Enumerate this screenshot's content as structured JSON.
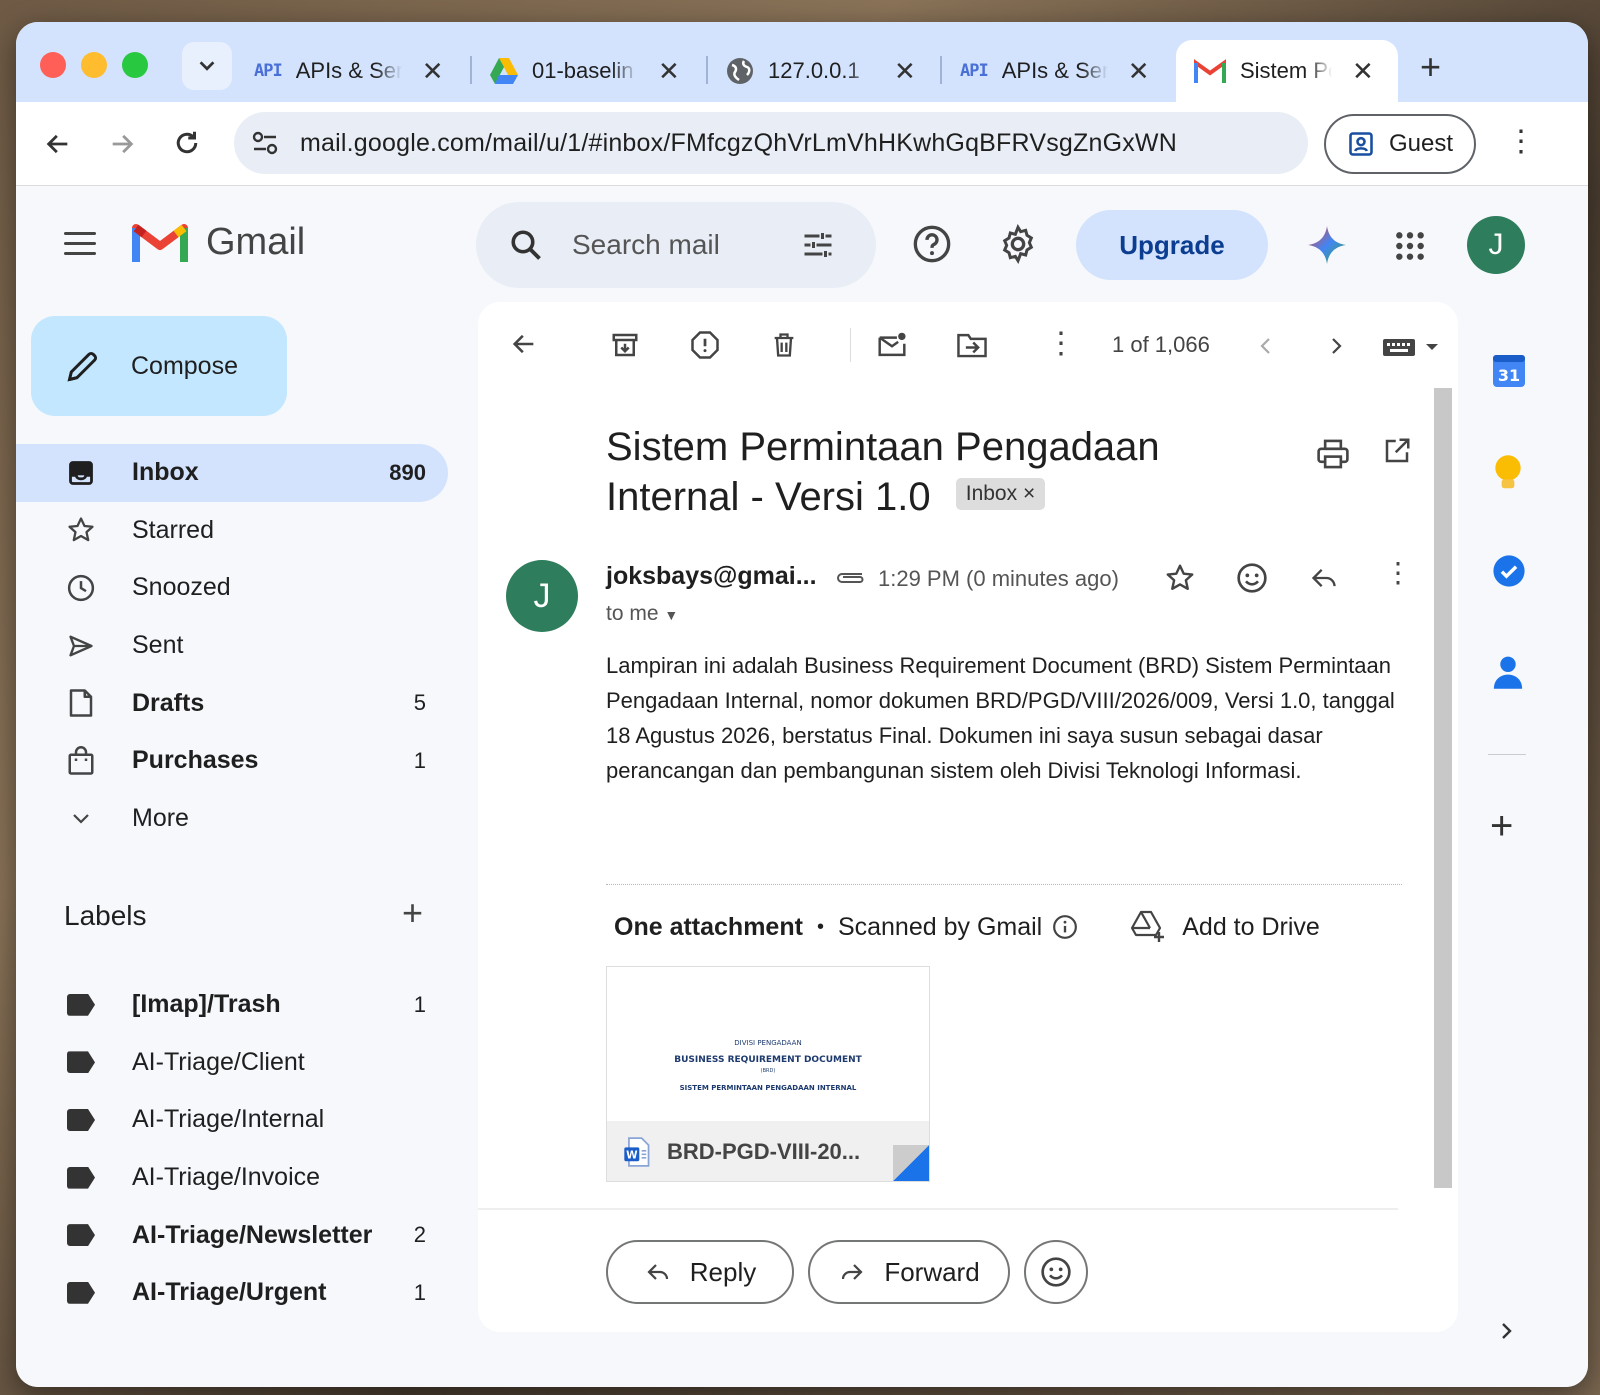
{
  "browser": {
    "tabs": [
      {
        "icon": "api-icon",
        "title": "APIs & Ser"
      },
      {
        "icon": "google-drive-icon",
        "title": "01-baselin"
      },
      {
        "icon": "globe-icon",
        "title": "127.0.0.1"
      },
      {
        "icon": "api-icon",
        "title": "APIs & Ser"
      },
      {
        "icon": "gmail-icon",
        "title": "Sistem Pe",
        "active": true
      }
    ],
    "url": "mail.google.com/mail/u/1/#inbox/FMfcgzQhVrLmVhHKwhGqBFRVsgZnGxWN",
    "profile_label": "Guest",
    "api_badge": "API"
  },
  "gmail": {
    "product_name": "Gmail",
    "search_placeholder": "Search mail",
    "upgrade_label": "Upgrade",
    "avatar_letter": "J",
    "compose_label": "Compose",
    "nav": [
      {
        "label": "Inbox",
        "count": "890",
        "bold": true,
        "icon": "inbox-icon",
        "active": true
      },
      {
        "label": "Starred",
        "count": "",
        "bold": false,
        "icon": "star-icon"
      },
      {
        "label": "Snoozed",
        "count": "",
        "bold": false,
        "icon": "clock-icon"
      },
      {
        "label": "Sent",
        "count": "",
        "bold": false,
        "icon": "send-icon"
      },
      {
        "label": "Drafts",
        "count": "5",
        "bold": true,
        "icon": "draft-icon"
      },
      {
        "label": "Purchases",
        "count": "1",
        "bold": true,
        "icon": "shopping-bag-icon"
      },
      {
        "label": "More",
        "count": "",
        "bold": false,
        "icon": "chevron-down-icon"
      }
    ],
    "labels_title": "Labels",
    "labels": [
      {
        "label": "[Imap]/Trash",
        "count": "1",
        "bold": true
      },
      {
        "label": "AI-Triage/Client",
        "count": "",
        "bold": false
      },
      {
        "label": "AI-Triage/Internal",
        "count": "",
        "bold": false
      },
      {
        "label": "AI-Triage/Invoice",
        "count": "",
        "bold": false
      },
      {
        "label": "AI-Triage/Newsletter",
        "count": "2",
        "bold": true
      },
      {
        "label": "AI-Triage/Urgent",
        "count": "1",
        "bold": true
      }
    ],
    "pager": "1 of 1,066",
    "email": {
      "subject": "Sistem Permintaan Pengadaan Internal - Versi 1.0",
      "folder_chip": "Inbox",
      "sender_initial": "J",
      "sender": "joksbays@gmai...",
      "time": "1:29 PM (0 minutes ago)",
      "recipient": "to me",
      "body": "Lampiran ini adalah Business Requirement Document (BRD) Sistem Permintaan Pengadaan Internal, nomor dokumen BRD/PGD/VIII/2026/009, Versi 1.0, tanggal 18 Agustus 2026, berstatus Final. Dokumen ini saya susun sebagai dasar perancangan dan pembangunan sistem oleh Divisi Teknologi Informasi.",
      "attachment_heading": "One attachment",
      "scanned_text": "Scanned by Gmail",
      "add_to_drive": "Add to Drive",
      "attachment": {
        "filename": "BRD-PGD-VIII-20...",
        "preview_line1": "DIVISI PENGADAAN",
        "preview_line2": "BUSINESS REQUIREMENT DOCUMENT",
        "preview_line3": "(BRD)",
        "preview_line4": "SISTEM PERMINTAAN PENGADAAN INTERNAL"
      },
      "reply_label": "Reply",
      "forward_label": "Forward"
    },
    "rail": {
      "calendar_day": "31"
    }
  }
}
